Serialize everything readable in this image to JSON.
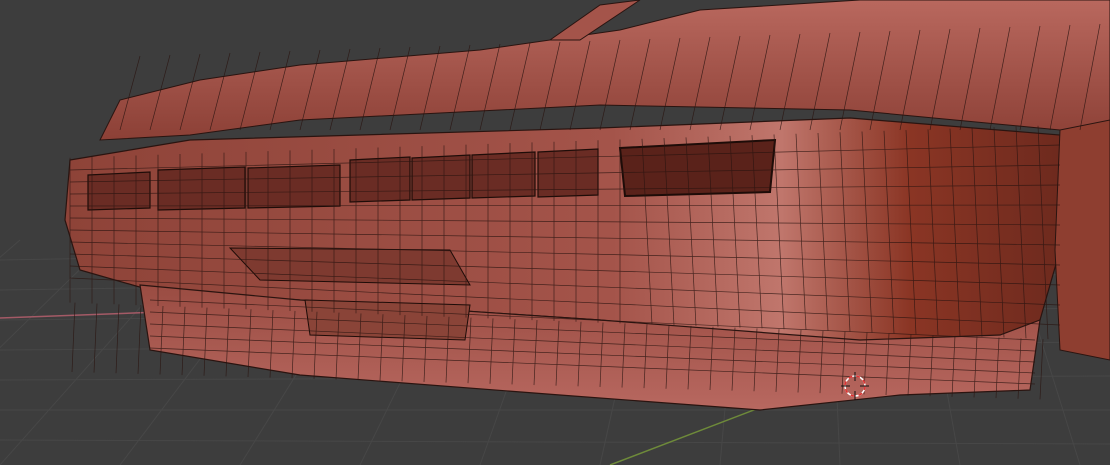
{
  "viewport": {
    "mode": "solid-wireframe-overlay",
    "colors": {
      "background": "#3d3d3d",
      "grid": "#474747",
      "x_axis": "#a45a66",
      "y_axis": "#6e8a3a",
      "mesh_light": "#c07066",
      "mesh_mid": "#9c4a3e",
      "mesh_dark": "#6e2a1e",
      "wire": "#2a1410",
      "cursor_red": "#e03030",
      "cursor_white": "#ffffff"
    }
  }
}
